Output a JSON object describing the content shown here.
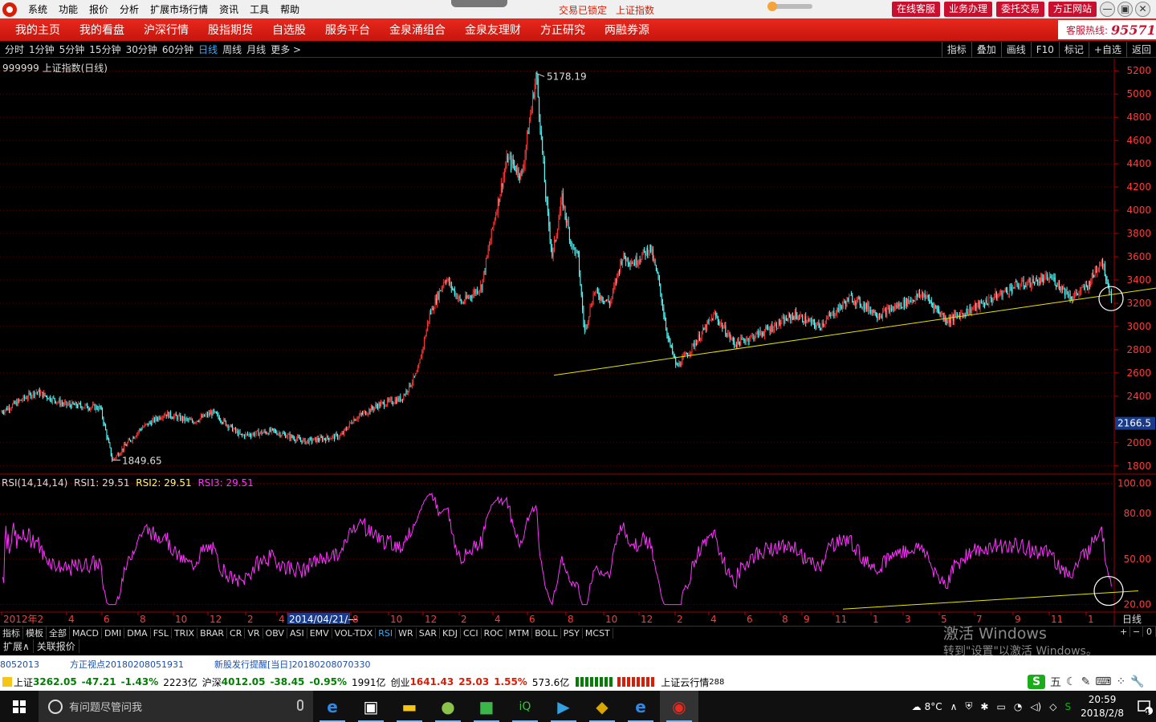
{
  "menubar": {
    "items": [
      "系统",
      "功能",
      "报价",
      "分析",
      "扩展市场行情",
      "资讯",
      "工具",
      "帮助"
    ],
    "lock_text": "交易已锁定",
    "index_text": "上证指数",
    "right_buttons": [
      "在线客服",
      "业务办理",
      "委托交易",
      "方正网站"
    ],
    "window_buttons": [
      "—",
      "▣",
      "✕"
    ]
  },
  "navbar": {
    "items": [
      "我的主页",
      "我的看盘",
      "沪深行情",
      "股指期货",
      "自选股",
      "服务平台",
      "金泉涌组合",
      "金泉友理财",
      "方正研究",
      "两融券源"
    ],
    "hotline_label": "客服热线:",
    "hotline_number": "95571"
  },
  "periodbar": {
    "periods": [
      "分时",
      "1分钟",
      "5分钟",
      "15分钟",
      "30分钟",
      "60分钟",
      "日线",
      "周线",
      "月线",
      "更多 >"
    ],
    "active": "日线",
    "tools": [
      "指标",
      "叠加",
      "画线",
      "F10",
      "标记",
      "+自选",
      "返回"
    ]
  },
  "main_chart": {
    "title": "999999 上证指数(日线)",
    "high_label": "5178.19",
    "low_label": "1849.65",
    "current_price_tag": "2166.5",
    "y_ticks": [
      "5200",
      "5000",
      "4800",
      "4600",
      "4400",
      "4200",
      "4000",
      "3800",
      "3600",
      "3400",
      "3200",
      "3000",
      "2800",
      "2600",
      "2400",
      "2000",
      "1800"
    ]
  },
  "rsi_chart": {
    "label_name": "RSI(14,14,14)",
    "rsi1": "RSI1: 29.51",
    "rsi2": "RSI2: 29.51",
    "rsi3": "RSI3: 29.51",
    "y_ticks": [
      "100.00",
      "80.00",
      "50.00",
      "20.00"
    ]
  },
  "time_axis": {
    "labels": [
      "2012年2",
      "4",
      "6",
      "8",
      "10",
      "12",
      "2",
      "4",
      "2014/04/21/—",
      "8",
      "10",
      "12",
      "2",
      "4",
      "6",
      "8",
      "10",
      "12",
      "2",
      "4",
      "6",
      "8",
      "9",
      "11",
      "1",
      "3",
      "5",
      "7",
      "9",
      "11",
      "1"
    ],
    "period_label": "日线"
  },
  "indicator_tabs": {
    "items": [
      "指标",
      "模板",
      "全部",
      "MACD",
      "DMI",
      "DMA",
      "FSL",
      "TRIX",
      "BRAR",
      "CR",
      "VR",
      "OBV",
      "ASI",
      "EMV",
      "VOL-TDX",
      "RSI",
      "WR",
      "SAR",
      "KDJ",
      "CCI",
      "ROC",
      "MTM",
      "BOLL",
      "PSY",
      "MCST"
    ],
    "active": "RSI",
    "controls": [
      "+",
      "−",
      "0"
    ]
  },
  "ext_tabs": [
    "扩展∧",
    "关联报价"
  ],
  "watermark": {
    "line1": "激活 Windows",
    "line2": "转到\"设置\"以激活 Windows。"
  },
  "ticker": [
    "8052013",
    "方正视点20180208051931",
    "新股发行提醒[当日]20180208070330"
  ],
  "status": {
    "sh_label": "上证",
    "sh_value": "3262.05",
    "sh_change": "-47.21",
    "sh_pct": "-1.43%",
    "sh_amount": "2223亿",
    "hs_label": "沪深",
    "hs_value": "4012.05",
    "hs_change": "-38.45",
    "hs_pct": "-0.95%",
    "hs_amount": "1991亿",
    "cy_label": "创业",
    "cy_value": "1641.43",
    "cy_change": "25.03",
    "cy_pct": "1.55%",
    "cy_amount": "573.6亿",
    "cloud": "上证云行情",
    "cloud_num": "288",
    "ime": [
      "五",
      "☾",
      "✎",
      "⌨",
      "⁘",
      "🔧"
    ]
  },
  "taskbar": {
    "search_placeholder": "有问题尽管问我",
    "weather": "8°C",
    "time": "20:59",
    "date": "2018/2/8",
    "notif_count": "4"
  },
  "colors": {
    "up": "#ff3333",
    "down": "#54ffff",
    "rsi": "#ff33ff",
    "trendline": "#e6e600",
    "grid": "#5a0000",
    "axis_text": "#ff3b3b"
  }
}
